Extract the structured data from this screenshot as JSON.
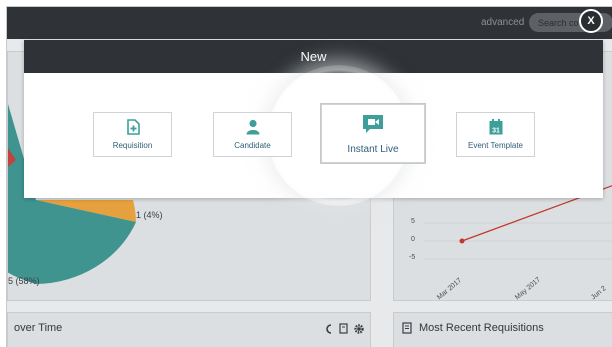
{
  "topbar": {
    "advanced_label": "advanced",
    "search_placeholder": "Search co"
  },
  "close_button": {
    "label": "X"
  },
  "dashboard": {
    "pie_labels": [
      "1 (4%)",
      "5 (58%)"
    ],
    "line_chart": {
      "y_ticks": [
        "5",
        "0",
        "-5"
      ],
      "x_ticks": [
        "Mar 2017",
        "May 2017",
        "Jun 2"
      ],
      "line_color": "#c0392b"
    },
    "bottom_left_title": "over Time",
    "bottom_right_title": "Most Recent Requisitions"
  },
  "modal": {
    "title": "New",
    "tiles": [
      {
        "label": "Requisition",
        "icon": "add-file-icon"
      },
      {
        "label": "Candidate",
        "icon": "person-icon"
      },
      {
        "label": "Instant Live",
        "icon": "video-chat-icon"
      },
      {
        "label": "Event Template",
        "icon": "calendar-icon",
        "icon_text": "31"
      }
    ],
    "accent_color": "#3e9e9a"
  }
}
